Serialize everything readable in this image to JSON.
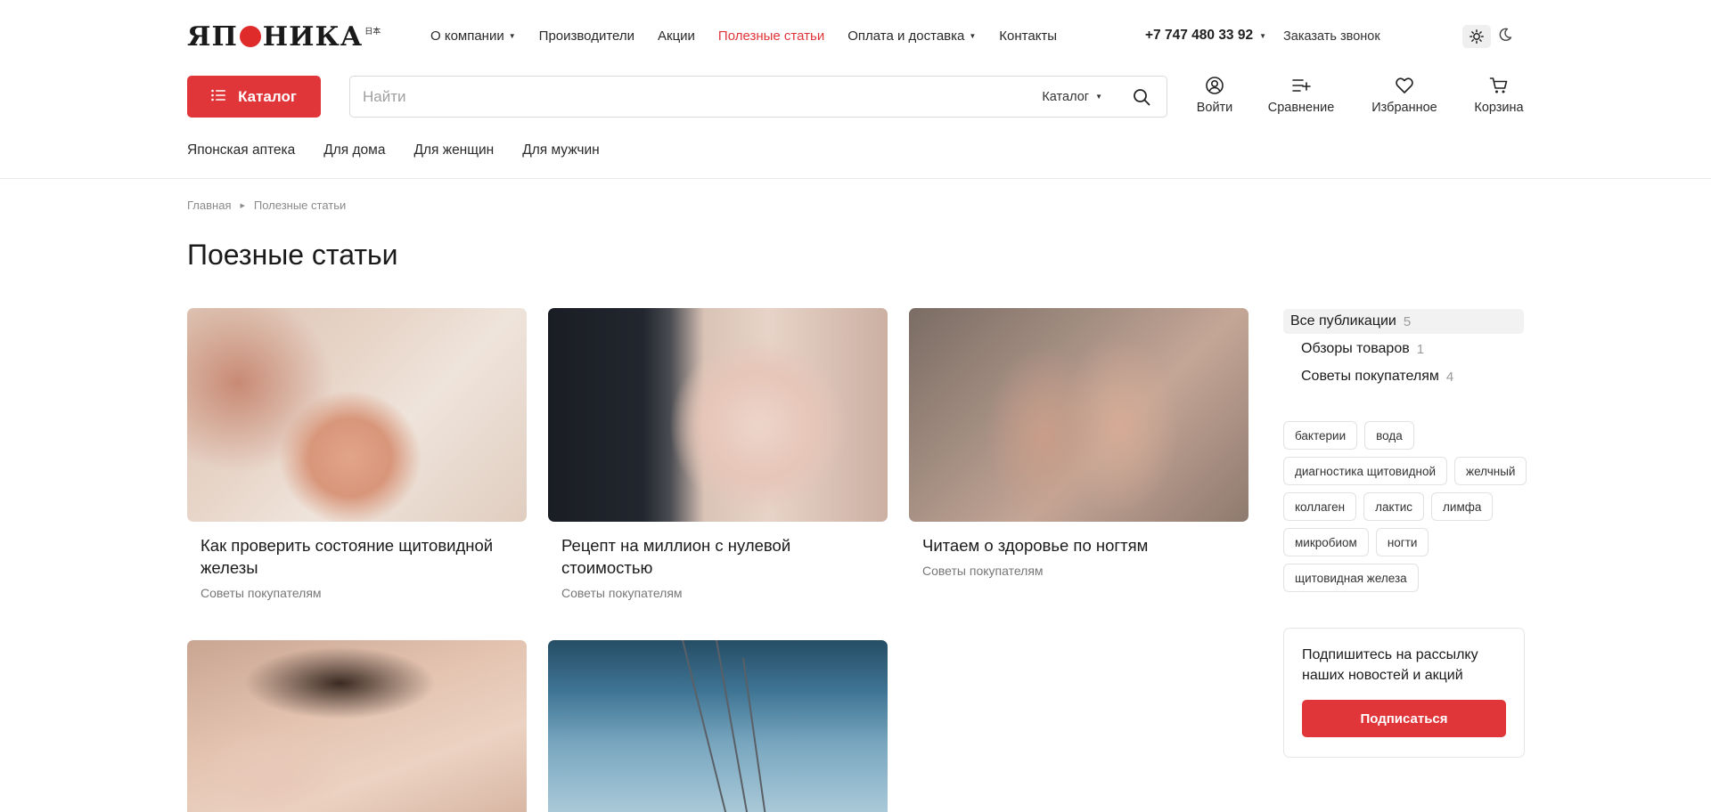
{
  "brand": {
    "logo_main": "ЯП",
    "logo_rest": "НИКА",
    "logo_jp": "日本"
  },
  "topnav": [
    {
      "label": "О компании",
      "has_caret": true
    },
    {
      "label": "Производители",
      "has_caret": false
    },
    {
      "label": "Акции",
      "has_caret": false
    },
    {
      "label": "Полезные статьи",
      "has_caret": false,
      "active": true
    },
    {
      "label": "Оплата и доставка",
      "has_caret": true
    },
    {
      "label": "Контакты",
      "has_caret": false
    }
  ],
  "contact": {
    "phone": "+7 747 480 33 92",
    "callback": "Заказать звонок"
  },
  "catalog_button": "Каталог",
  "search": {
    "placeholder": "Найти",
    "scope": "Каталог"
  },
  "actions": {
    "login": "Войти",
    "compare": "Сравнение",
    "favorites": "Избранное",
    "cart": "Корзина"
  },
  "subnav": [
    "Японская аптека",
    "Для дома",
    "Для женщин",
    "Для мужчин"
  ],
  "breadcrumb": [
    "Главная",
    "Полезные статьи"
  ],
  "page_title": "Поезные статьи",
  "articles": [
    {
      "title": "Как проверить состояние щитовидной железы",
      "category": "Советы покупателям"
    },
    {
      "title": "Рецепт на миллион с нулевой стоимостью",
      "category": "Советы покупателям"
    },
    {
      "title": "Читаем о здоровье по ногтям",
      "category": "Советы покупателям"
    }
  ],
  "publications": [
    {
      "label": "Все публикации",
      "count": "5"
    },
    {
      "label": "Обзоры товаров",
      "count": "1"
    },
    {
      "label": "Советы покупателям",
      "count": "4"
    }
  ],
  "tags": [
    "бактерии",
    "вода",
    "диагностика щитовидной",
    "желчный",
    "коллаген",
    "лактис",
    "лимфа",
    "микробиом",
    "ногти",
    "щитовидная железа"
  ],
  "subscribe": {
    "text": "Подпишитесь на рассылку наших новостей и акций",
    "button": "Подписаться"
  },
  "colors": {
    "accent": "#e0363a"
  }
}
